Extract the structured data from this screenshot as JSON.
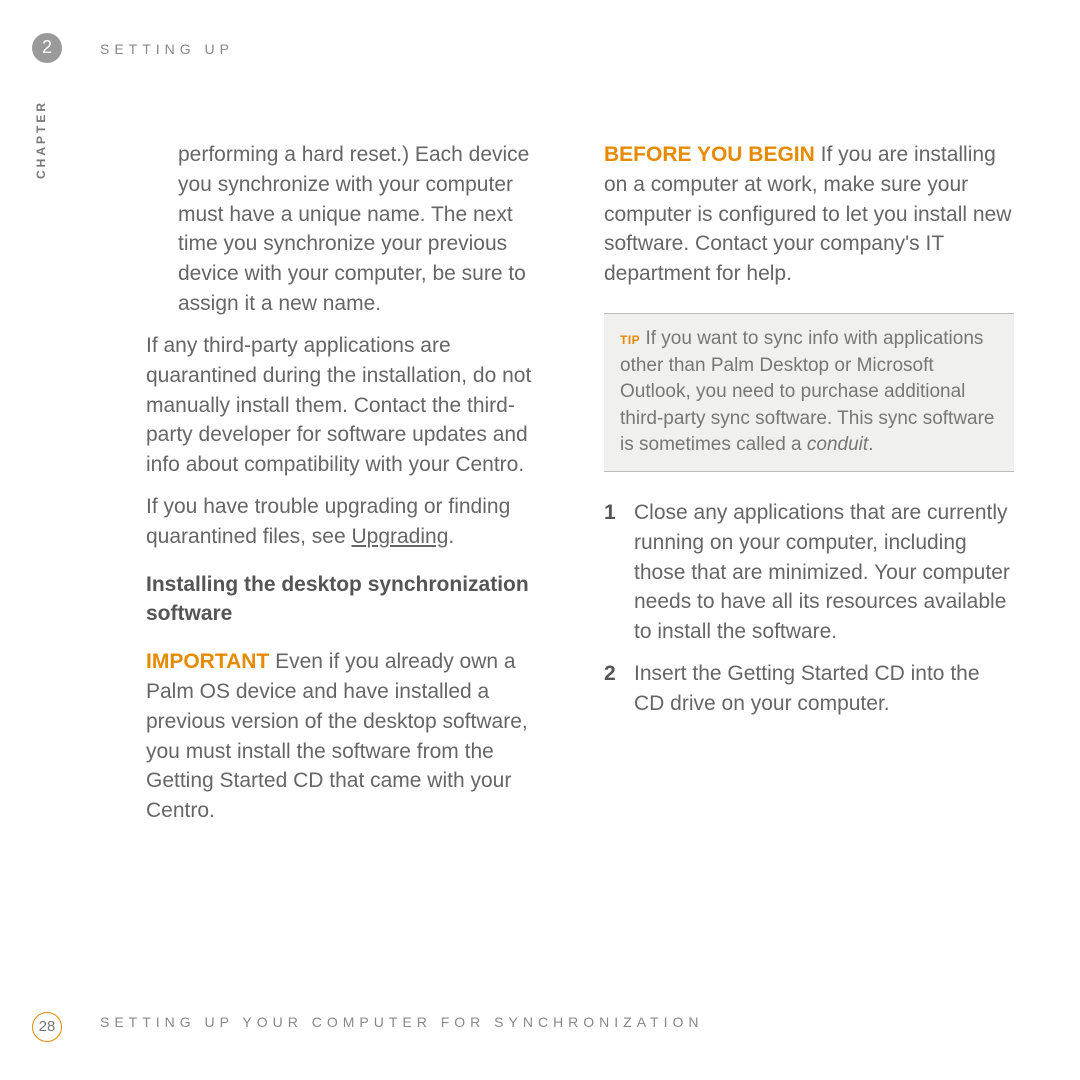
{
  "header": {
    "chapter_number": "2",
    "chapter_label": "CHAPTER",
    "running_header": "SETTING UP"
  },
  "left": {
    "indent_para": "performing a hard reset.) Each device you synchronize with your computer must have a unique name. The next time you synchronize your previous device with your computer, be sure to assign it a new name.",
    "para2": "If any third-party applications are quarantined during the installation, do not manually install them. Contact the third-party developer for software updates and info about compatibility with your Centro.",
    "para3_a": "If you have trouble upgrading or finding quarantined files, see ",
    "para3_link": "Upgrading",
    "para3_b": ".",
    "heading": "Installing the desktop synchronization software",
    "important_label": "IMPORTANT",
    "important_text": " Even if you already own a Palm OS device and have installed a previous version of the desktop software, you must install the software from the Getting Started CD that came with your Centro."
  },
  "right": {
    "before_label": "BEFORE YOU BEGIN",
    "before_text": " If you are installing on a computer at work, make sure your computer is configured to let you install new software. Contact your company's IT department for help.",
    "tip_label": "TIP",
    "tip_text_a": " If you want to sync info with applications other than Palm Desktop or Microsoft Outlook, you need to purchase additional third-party sync software. This sync software is sometimes called a ",
    "tip_text_italic": "conduit",
    "tip_text_b": ".",
    "steps": [
      {
        "num": "1",
        "text": "Close any applications that are currently running on your computer, including those that are minimized. Your computer needs to have all its resources available to install the software."
      },
      {
        "num": "2",
        "text": "Insert the Getting Started CD into the CD drive on your computer."
      }
    ]
  },
  "footer": {
    "page_number": "28",
    "running_footer": "SETTING UP YOUR COMPUTER FOR SYNCHRONIZATION"
  }
}
